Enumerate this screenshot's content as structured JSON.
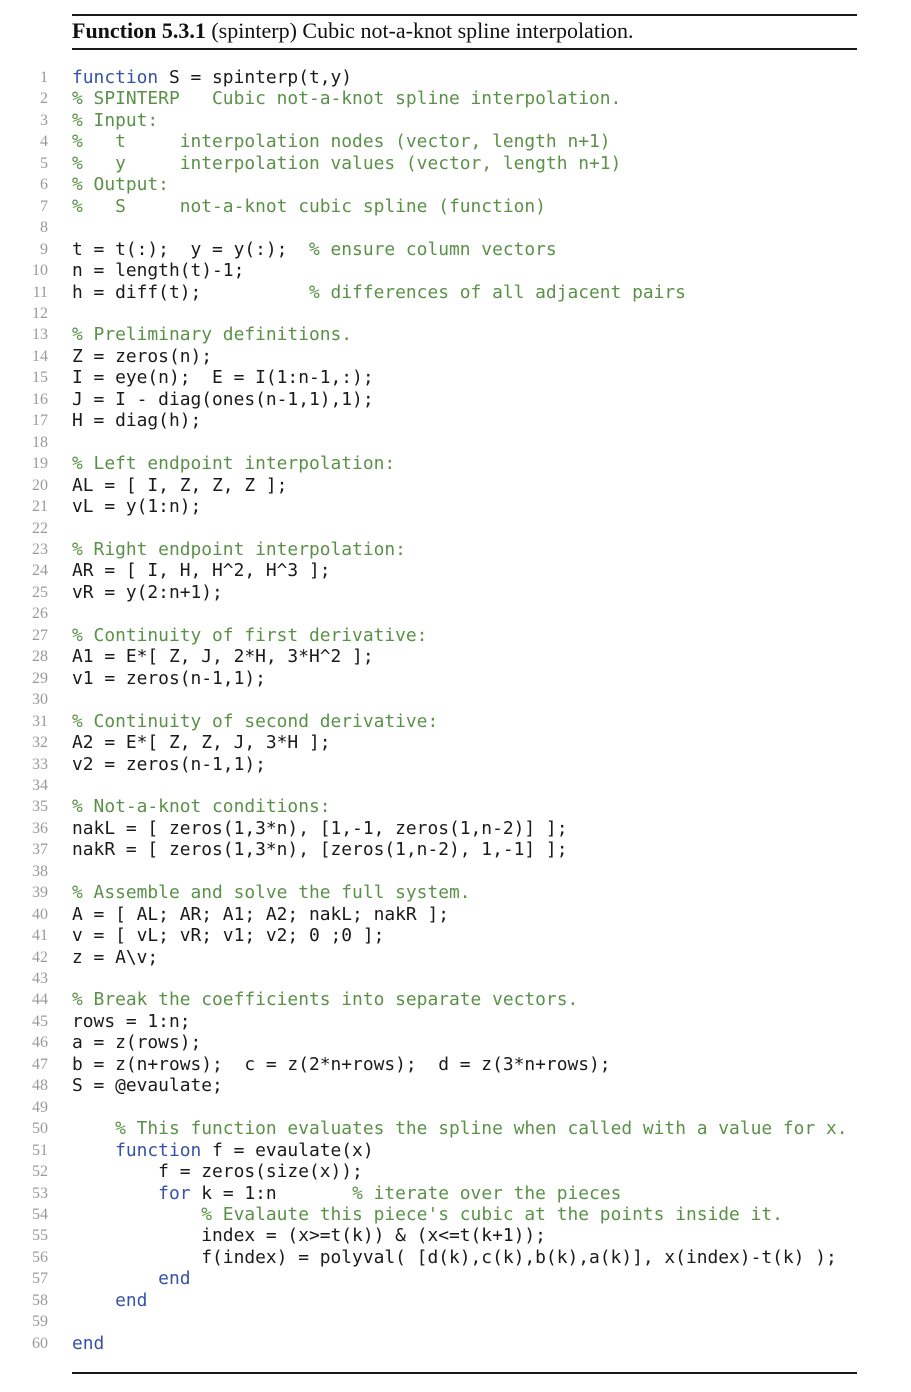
{
  "caption": {
    "label": "Function 5.3.1",
    "name": "(spinterp)",
    "text": "Cubic not-a-knot spline interpolation."
  },
  "colors": {
    "keyword": "#3553a4",
    "comment": "#5a9148",
    "code": "#1a1a1a",
    "line_number": "#9a9a9a"
  },
  "lines": [
    [
      {
        "t": "kw",
        "s": "function"
      },
      {
        "t": "c",
        "s": " S = spinterp(t,y)"
      }
    ],
    [
      {
        "t": "cm",
        "s": "% SPINTERP   Cubic not-a-knot spline interpolation."
      }
    ],
    [
      {
        "t": "cm",
        "s": "% Input:"
      }
    ],
    [
      {
        "t": "cm",
        "s": "%   t     interpolation nodes (vector, length n+1)"
      }
    ],
    [
      {
        "t": "cm",
        "s": "%   y     interpolation values (vector, length n+1)"
      }
    ],
    [
      {
        "t": "cm",
        "s": "% Output:"
      }
    ],
    [
      {
        "t": "cm",
        "s": "%   S     not-a-knot cubic spline (function)"
      }
    ],
    [],
    [
      {
        "t": "c",
        "s": "t = t(:);  y = y(:);  "
      },
      {
        "t": "cm",
        "s": "% ensure column vectors"
      }
    ],
    [
      {
        "t": "c",
        "s": "n = length(t)-1;"
      }
    ],
    [
      {
        "t": "c",
        "s": "h = diff(t);          "
      },
      {
        "t": "cm",
        "s": "% differences of all adjacent pairs"
      }
    ],
    [],
    [
      {
        "t": "cm",
        "s": "% Preliminary definitions."
      }
    ],
    [
      {
        "t": "c",
        "s": "Z = zeros(n);"
      }
    ],
    [
      {
        "t": "c",
        "s": "I = eye(n);  E = I(1:n-1,:);"
      }
    ],
    [
      {
        "t": "c",
        "s": "J = I - diag(ones(n-1,1),1);"
      }
    ],
    [
      {
        "t": "c",
        "s": "H = diag(h);"
      }
    ],
    [],
    [
      {
        "t": "cm",
        "s": "% Left endpoint interpolation:"
      }
    ],
    [
      {
        "t": "c",
        "s": "AL = [ I, Z, Z, Z ];"
      }
    ],
    [
      {
        "t": "c",
        "s": "vL = y(1:n);"
      }
    ],
    [],
    [
      {
        "t": "cm",
        "s": "% Right endpoint interpolation:"
      }
    ],
    [
      {
        "t": "c",
        "s": "AR = [ I, H, H^2, H^3 ];"
      }
    ],
    [
      {
        "t": "c",
        "s": "vR = y(2:n+1);"
      }
    ],
    [],
    [
      {
        "t": "cm",
        "s": "% Continuity of first derivative:"
      }
    ],
    [
      {
        "t": "c",
        "s": "A1 = E*[ Z, J, 2*H, 3*H^2 ];"
      }
    ],
    [
      {
        "t": "c",
        "s": "v1 = zeros(n-1,1);"
      }
    ],
    [],
    [
      {
        "t": "cm",
        "s": "% Continuity of second derivative:"
      }
    ],
    [
      {
        "t": "c",
        "s": "A2 = E*[ Z, Z, J, 3*H ];"
      }
    ],
    [
      {
        "t": "c",
        "s": "v2 = zeros(n-1,1);"
      }
    ],
    [],
    [
      {
        "t": "cm",
        "s": "% Not-a-knot conditions:"
      }
    ],
    [
      {
        "t": "c",
        "s": "nakL = [ zeros(1,3*n), [1,-1, zeros(1,n-2)] ];"
      }
    ],
    [
      {
        "t": "c",
        "s": "nakR = [ zeros(1,3*n), [zeros(1,n-2), 1,-1] ];"
      }
    ],
    [],
    [
      {
        "t": "cm",
        "s": "% Assemble and solve the full system."
      }
    ],
    [
      {
        "t": "c",
        "s": "A = [ AL; AR; A1; A2; nakL; nakR ];"
      }
    ],
    [
      {
        "t": "c",
        "s": "v = [ vL; vR; v1; v2; 0 ;0 ];"
      }
    ],
    [
      {
        "t": "c",
        "s": "z = A\\v;"
      }
    ],
    [],
    [
      {
        "t": "cm",
        "s": "% Break the coefficients into separate vectors."
      }
    ],
    [
      {
        "t": "c",
        "s": "rows = 1:n;"
      }
    ],
    [
      {
        "t": "c",
        "s": "a = z(rows);"
      }
    ],
    [
      {
        "t": "c",
        "s": "b = z(n+rows);  c = z(2*n+rows);  d = z(3*n+rows);"
      }
    ],
    [
      {
        "t": "c",
        "s": "S = @evaulate;"
      }
    ],
    [],
    [
      {
        "t": "c",
        "s": "    "
      },
      {
        "t": "cm",
        "s": "% This function evaluates the spline when called with a value for x."
      }
    ],
    [
      {
        "t": "c",
        "s": "    "
      },
      {
        "t": "kw",
        "s": "function"
      },
      {
        "t": "c",
        "s": " f = evaulate(x)"
      }
    ],
    [
      {
        "t": "c",
        "s": "        f = zeros(size(x));"
      }
    ],
    [
      {
        "t": "c",
        "s": "        "
      },
      {
        "t": "kw",
        "s": "for"
      },
      {
        "t": "c",
        "s": " k = 1:n       "
      },
      {
        "t": "cm",
        "s": "% iterate over the pieces"
      }
    ],
    [
      {
        "t": "c",
        "s": "            "
      },
      {
        "t": "cm",
        "s": "% Evalaute this piece's cubic at the points inside it."
      }
    ],
    [
      {
        "t": "c",
        "s": "            index = (x>=t(k)) & (x<=t(k+1));"
      }
    ],
    [
      {
        "t": "c",
        "s": "            f(index) = polyval( [d(k),c(k),b(k),a(k)], x(index)-t(k) );"
      }
    ],
    [
      {
        "t": "c",
        "s": "        "
      },
      {
        "t": "kw",
        "s": "end"
      }
    ],
    [
      {
        "t": "c",
        "s": "    "
      },
      {
        "t": "kw",
        "s": "end"
      }
    ],
    [],
    [
      {
        "t": "kw",
        "s": "end"
      }
    ]
  ]
}
